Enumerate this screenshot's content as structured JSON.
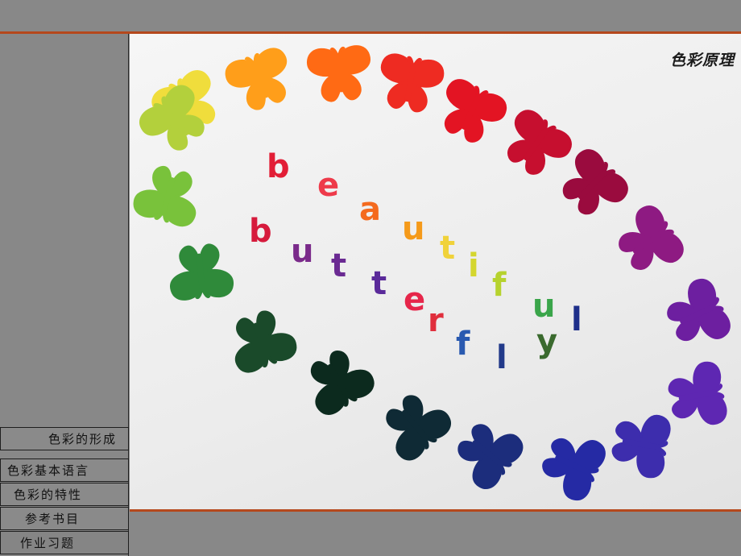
{
  "header": {
    "title": "色彩原理"
  },
  "menu": [
    {
      "label": "色彩的形成"
    },
    {
      "label": "色彩基本语言"
    },
    {
      "label": "色彩的特性"
    },
    {
      "label": "参考书目"
    },
    {
      "label": "作业习题"
    }
  ],
  "photo": {
    "words": [
      "beautiful",
      "butterfly"
    ],
    "butterfly_colors": [
      "#f0dd3c",
      "#ff9e1a",
      "#ff6a14",
      "#ee2b22",
      "#e31423",
      "#c60f2f",
      "#9a0b3e",
      "#8e1a82",
      "#6d1fa0",
      "#5e27b2",
      "#3d2dad",
      "#252aa4",
      "#1c2d7c",
      "#0f2a35",
      "#0c2a1e",
      "#1a4a2a",
      "#2f8a3a",
      "#79c23b",
      "#b3d03c"
    ],
    "letter_colors": {
      "beautiful": [
        "#e21e36",
        "#ee3a4a",
        "#f46a1e",
        "#f59a1a",
        "#f0d23a",
        "#d4d62e",
        "#b6d22e",
        "#3aa54a",
        "#1e2f8a"
      ],
      "butterfly": [
        "#d61a3c",
        "#7a2a8a",
        "#6a2a92",
        "#5a2a9a",
        "#e6264a",
        "#e02e3c",
        "#2a5ab0",
        "#223a8a",
        "#3a6a2e"
      ]
    }
  }
}
